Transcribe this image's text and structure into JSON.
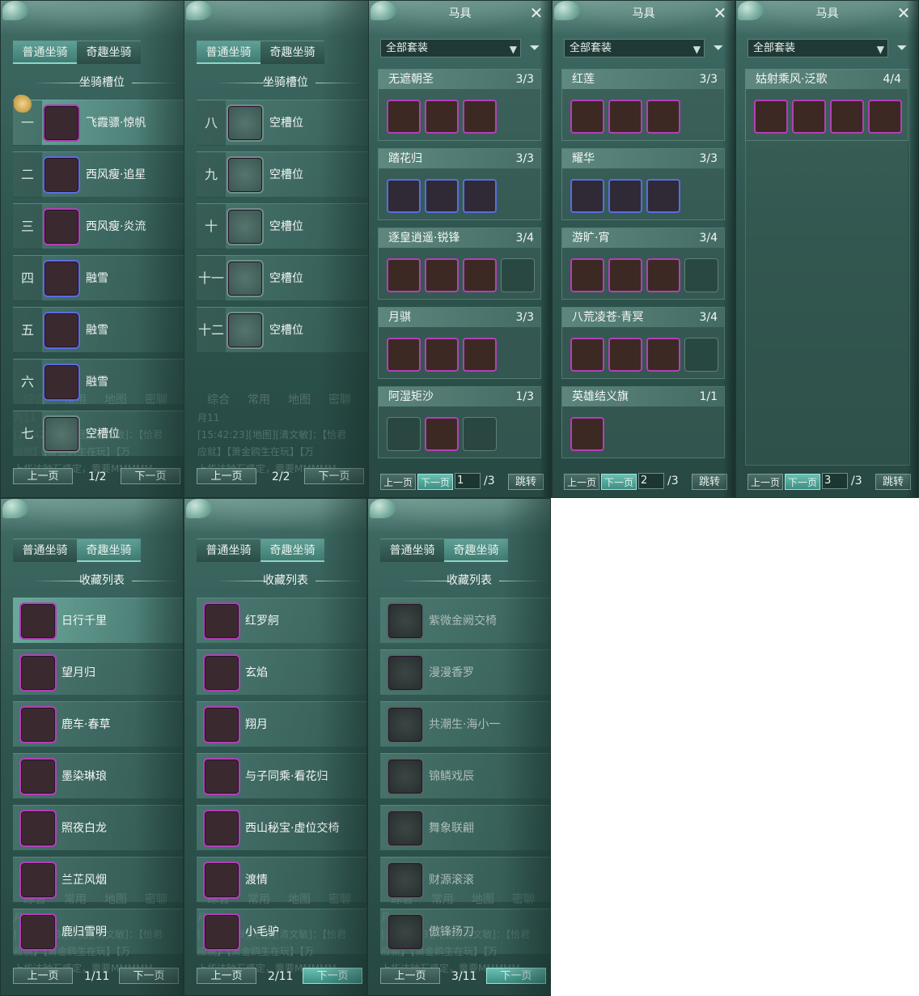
{
  "mount_panels": [
    {
      "tabs": [
        "普通坐骑",
        "奇趣坐骑"
      ],
      "active_tab": 0,
      "section": "坐骑槽位",
      "rows": [
        {
          "num": "一",
          "name": "飞霞骠·惊帆",
          "icon": "white-horse-icon",
          "rarity": "purple"
        },
        {
          "num": "二",
          "name": "西风瘦·追星",
          "icon": "white-horse-icon",
          "rarity": "blue"
        },
        {
          "num": "三",
          "name": "西风瘦·炎流",
          "icon": "black-horse-icon",
          "rarity": "purple"
        },
        {
          "num": "四",
          "name": "融雪",
          "icon": "white-horse-icon",
          "rarity": "blue"
        },
        {
          "num": "五",
          "name": "融雪",
          "icon": "white-horse-icon",
          "rarity": "blue"
        },
        {
          "num": "六",
          "name": "融雪",
          "icon": "white-horse-icon",
          "rarity": "blue"
        },
        {
          "num": "七",
          "name": "空槽位",
          "icon": "empty-slot-icon",
          "rarity": "empty"
        }
      ],
      "prev": "上一页",
      "next": "下一页",
      "page": "1/2"
    },
    {
      "tabs": [
        "普通坐骑",
        "奇趣坐骑"
      ],
      "active_tab": 0,
      "section": "坐骑槽位",
      "rows": [
        {
          "num": "八",
          "name": "空槽位",
          "icon": "empty-slot-icon",
          "rarity": "empty"
        },
        {
          "num": "九",
          "name": "空槽位",
          "icon": "empty-slot-icon",
          "rarity": "empty"
        },
        {
          "num": "十",
          "name": "空槽位",
          "icon": "empty-slot-icon",
          "rarity": "empty"
        },
        {
          "num": "十一",
          "name": "空槽位",
          "icon": "empty-slot-icon",
          "rarity": "empty"
        },
        {
          "num": "十二",
          "name": "空槽位",
          "icon": "empty-slot-icon",
          "rarity": "empty"
        }
      ],
      "prev": "上一页",
      "next": "下一页",
      "page": "2/2"
    }
  ],
  "chat_bg": {
    "tabs": [
      "综合",
      "常用",
      "地图",
      "密聊"
    ],
    "lines": [
      "月11",
      "[15:42:23][地图][清文敏]：【恰君",
      "应就】【萧金鸥生在玩】【万",
      "上华达钟石盛定，需要MMMMM"
    ]
  },
  "gear_panels": [
    {
      "title": "马具",
      "filter_value": "全部套装",
      "sets": [
        {
          "name": "无遮朝圣",
          "count": "3/3",
          "slots": [
            "purple",
            "purple",
            "purple"
          ]
        },
        {
          "name": "踏花归",
          "count": "3/3",
          "slots": [
            "blue",
            "blue",
            "blue"
          ]
        },
        {
          "name": "逐皇逍遥·锐锋",
          "count": "3/4",
          "slots": [
            "purple",
            "purple",
            "purple",
            "empty"
          ]
        },
        {
          "name": "月骐",
          "count": "3/3",
          "slots": [
            "purple",
            "purple",
            "purple"
          ]
        },
        {
          "name": "阿湿矩沙",
          "count": "1/3",
          "slots": [
            "empty",
            "purple",
            "empty"
          ]
        }
      ],
      "prev": "上一页",
      "next": "下一页",
      "page_input": "1",
      "page_total": "/3",
      "jump": "跳转"
    },
    {
      "title": "马具",
      "filter_value": "全部套装",
      "sets": [
        {
          "name": "红莲",
          "count": "3/3",
          "slots": [
            "purple",
            "purple",
            "purple"
          ]
        },
        {
          "name": "耀华",
          "count": "3/3",
          "slots": [
            "blue",
            "blue",
            "blue"
          ]
        },
        {
          "name": "游旷·宵",
          "count": "3/4",
          "slots": [
            "purple",
            "purple",
            "purple",
            "empty"
          ]
        },
        {
          "name": "八荒凌苍·青冥",
          "count": "3/4",
          "slots": [
            "purple",
            "purple",
            "purple",
            "empty"
          ]
        },
        {
          "name": "英雄结义旗",
          "count": "1/1",
          "slots": [
            "purple"
          ]
        }
      ],
      "prev": "上一页",
      "next": "下一页",
      "page_input": "2",
      "page_total": "/3",
      "jump": "跳转"
    },
    {
      "title": "马具",
      "filter_value": "全部套装",
      "sets": [
        {
          "name": "姑射乘风·泛歌",
          "count": "4/4",
          "slots": [
            "purple",
            "purple",
            "purple",
            "purple"
          ]
        }
      ],
      "prev": "上一页",
      "next": "下一页",
      "page_input": "3",
      "page_total": "/3",
      "jump": "跳转"
    }
  ],
  "fun_panels": [
    {
      "tabs": [
        "普通坐骑",
        "奇趣坐骑"
      ],
      "active_tab": 1,
      "section": "收藏列表",
      "rows": [
        {
          "name": "日行千里",
          "icon": "golden-horse-icon",
          "owned": true
        },
        {
          "name": "望月归",
          "icon": "crane-icon",
          "owned": true
        },
        {
          "name": "鹿车·春草",
          "icon": "deer-cart-icon",
          "owned": true
        },
        {
          "name": "墨染琳琅",
          "icon": "panda-icon",
          "owned": true
        },
        {
          "name": "照夜白龙",
          "icon": "white-dragon-icon",
          "owned": true
        },
        {
          "name": "兰芷风烟",
          "icon": "boat-icon",
          "owned": true
        },
        {
          "name": "鹿归雪明",
          "icon": "reindeer-icon",
          "owned": true
        }
      ],
      "prev": "上一页",
      "next": "下一页",
      "page": "1/11",
      "next_hot": false
    },
    {
      "tabs": [
        "普通坐骑",
        "奇趣坐骑"
      ],
      "active_tab": 1,
      "section": "收藏列表",
      "rows": [
        {
          "name": "红罗舸",
          "icon": "red-boat-icon",
          "owned": true
        },
        {
          "name": "玄焰",
          "icon": "dark-beast-icon",
          "owned": true
        },
        {
          "name": "翔月",
          "icon": "white-horse-icon",
          "owned": true
        },
        {
          "name": "与子同乘·看花归",
          "icon": "flower-horse-icon",
          "owned": true
        },
        {
          "name": "西山秘宝·虚位交椅",
          "icon": "lady-portrait-icon",
          "owned": true
        },
        {
          "name": "渡情",
          "icon": "bamboo-raft-icon",
          "owned": true
        },
        {
          "name": "小毛驴",
          "icon": "donkey-icon",
          "owned": true
        }
      ],
      "prev": "上一页",
      "next": "下一页",
      "page": "2/11",
      "next_hot": true
    },
    {
      "tabs": [
        "普通坐骑",
        "奇趣坐骑"
      ],
      "active_tab": 1,
      "section": "收藏列表",
      "rows": [
        {
          "name": "紫微金阙交椅",
          "icon": "throne-icon",
          "owned": false
        },
        {
          "name": "漫漫香罗",
          "icon": "carriage-icon",
          "owned": false
        },
        {
          "name": "共潮生·海小一",
          "icon": "fish-icon",
          "owned": false
        },
        {
          "name": "锦鳞戏辰",
          "icon": "koi-icon",
          "owned": false
        },
        {
          "name": "舞象联翩",
          "icon": "elephant-icon",
          "owned": false
        },
        {
          "name": "财源滚滚",
          "icon": "money-cart-icon",
          "owned": false
        },
        {
          "name": "傲锋扬刀",
          "icon": "armor-icon",
          "owned": false
        }
      ],
      "prev": "上一页",
      "next": "下一页",
      "page": "3/11",
      "next_hot": true
    }
  ],
  "colors": {
    "panel": "#2f5650",
    "accent": "#68c0b3",
    "purple_frame": "#b33fb8",
    "blue_frame": "#5a6ce0"
  }
}
